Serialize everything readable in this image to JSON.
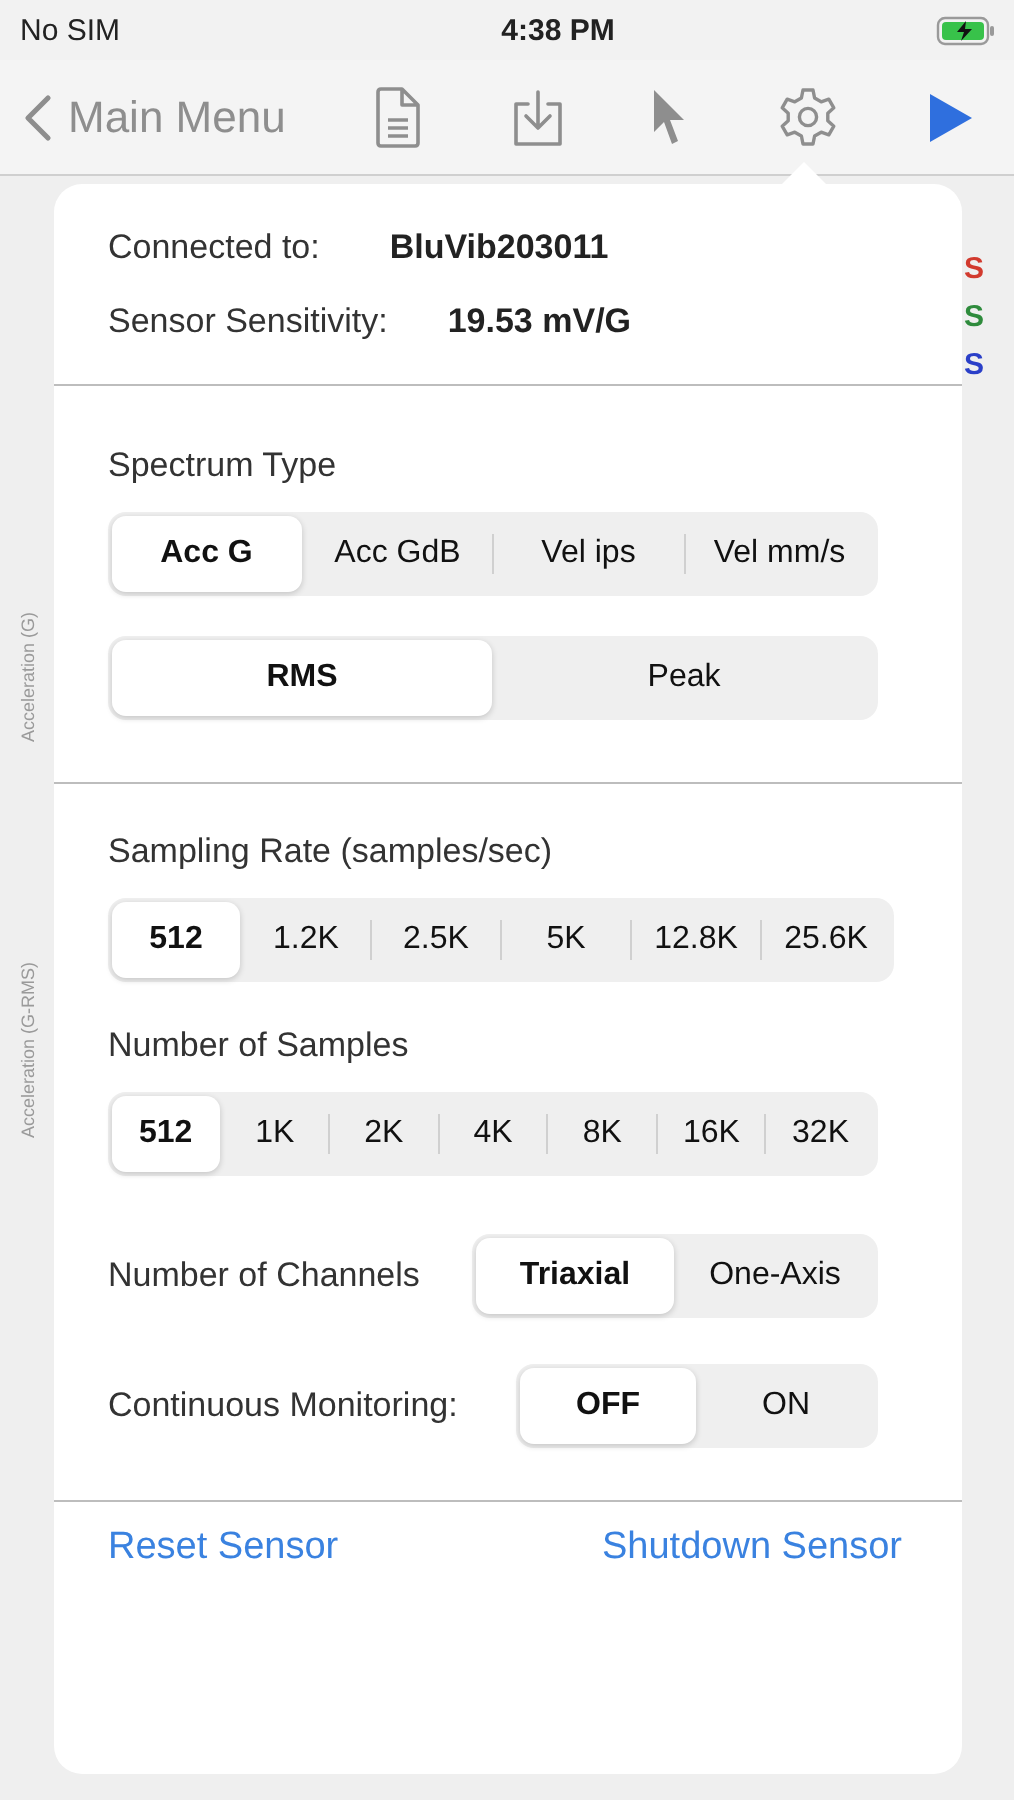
{
  "status_bar": {
    "carrier": "No SIM",
    "time": "4:38 PM"
  },
  "nav_bar": {
    "back_label": "Main Menu"
  },
  "background": {
    "axis_labels": [
      "Acceleration (G)",
      "Acceleration (G-RMS)"
    ],
    "legend": [
      {
        "text": "S",
        "color": "#d23a2e"
      },
      {
        "text": "S",
        "color": "#2e8b3c"
      },
      {
        "text": "S",
        "color": "#2a3fc8"
      }
    ]
  },
  "popover": {
    "connected_label": "Connected to:",
    "connected_value": "BluVib203011",
    "sensitivity_label": "Sensor Sensitivity:",
    "sensitivity_value": "19.53 mV/G",
    "spectrum_type": {
      "label": "Spectrum Type",
      "units": [
        {
          "label": "Acc G",
          "selected": true
        },
        {
          "label": "Acc GdB",
          "selected": false
        },
        {
          "label": "Vel ips",
          "selected": false
        },
        {
          "label": "Vel mm/s",
          "selected": false
        }
      ],
      "measure": [
        {
          "label": "RMS",
          "selected": true
        },
        {
          "label": "Peak",
          "selected": false
        }
      ]
    },
    "sampling_rate": {
      "label": "Sampling Rate (samples/sec)",
      "options": [
        {
          "label": "512",
          "selected": true
        },
        {
          "label": "1.2K",
          "selected": false
        },
        {
          "label": "2.5K",
          "selected": false
        },
        {
          "label": "5K",
          "selected": false
        },
        {
          "label": "12.8K",
          "selected": false
        },
        {
          "label": "25.6K",
          "selected": false
        }
      ]
    },
    "number_of_samples": {
      "label": "Number of Samples",
      "options": [
        {
          "label": "512",
          "selected": true
        },
        {
          "label": "1K",
          "selected": false
        },
        {
          "label": "2K",
          "selected": false
        },
        {
          "label": "4K",
          "selected": false
        },
        {
          "label": "8K",
          "selected": false
        },
        {
          "label": "16K",
          "selected": false
        },
        {
          "label": "32K",
          "selected": false
        }
      ]
    },
    "number_of_channels": {
      "label": "Number of Channels",
      "options": [
        {
          "label": "Triaxial",
          "selected": true
        },
        {
          "label": "One-Axis",
          "selected": false
        }
      ]
    },
    "continuous_monitoring": {
      "label": "Continuous Monitoring:",
      "options": [
        {
          "label": "OFF",
          "selected": true
        },
        {
          "label": "ON",
          "selected": false
        }
      ]
    },
    "actions": [
      "Reset Sensor",
      "Shutdown Sensor"
    ]
  }
}
